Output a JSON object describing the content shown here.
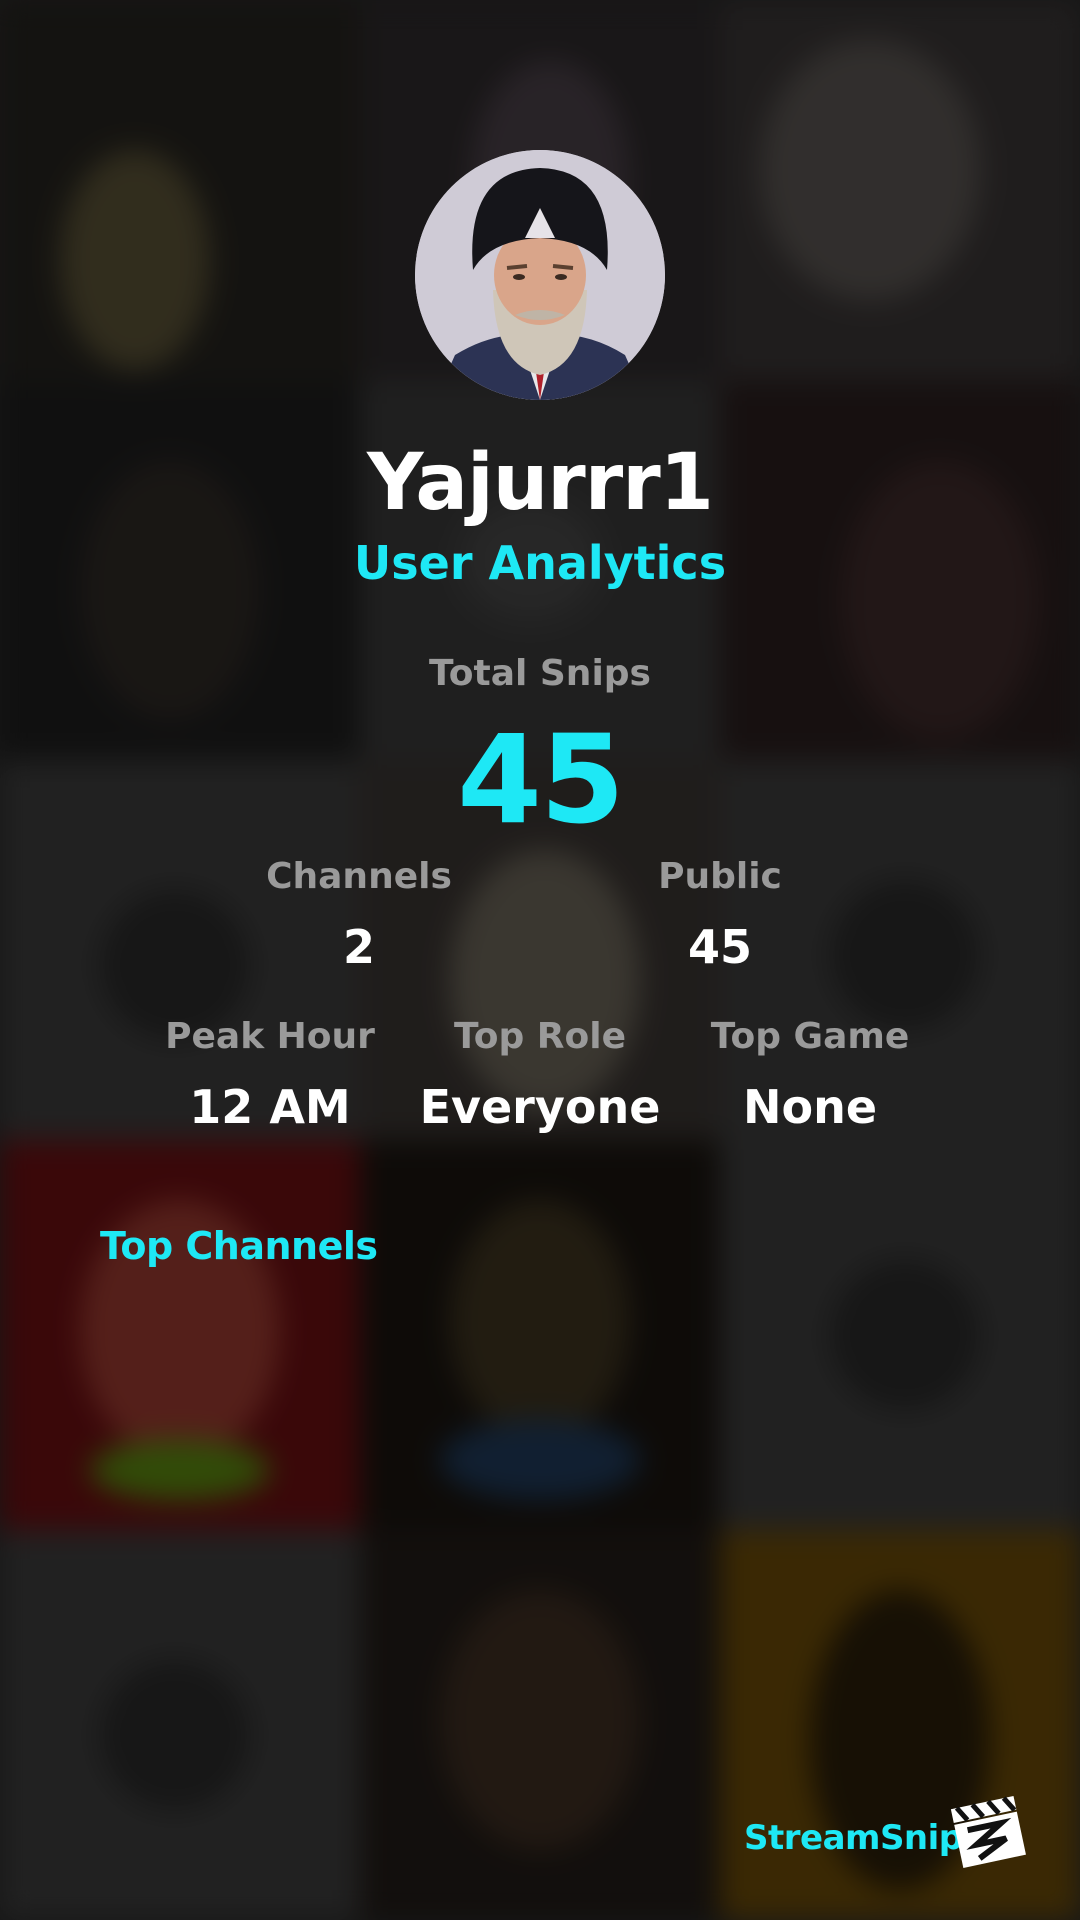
{
  "profile": {
    "username": "Yajurrr1",
    "subtitle": "User Analytics",
    "avatar_icon": "user-avatar-photo"
  },
  "totals": {
    "label": "Total Snips",
    "value": "45"
  },
  "stats_row1": {
    "channels": {
      "label": "Channels",
      "value": "2"
    },
    "public": {
      "label": "Public",
      "value": "45"
    }
  },
  "stats_row2": {
    "peak_hour": {
      "label": "Peak Hour",
      "value": "12 AM"
    },
    "top_role": {
      "label": "Top Role",
      "value": "Everyone"
    },
    "top_game": {
      "label": "Top Game",
      "value": "None"
    }
  },
  "sections": {
    "top_channels_title": "Top Channels"
  },
  "footer": {
    "brand_name": "StreamSnip",
    "brand_icon": "clapperboard-logo-icon"
  },
  "colors": {
    "accent": "#1ee8f5",
    "muted": "#9a9a9a",
    "text": "#ffffff",
    "background": "#2a2a2a"
  }
}
